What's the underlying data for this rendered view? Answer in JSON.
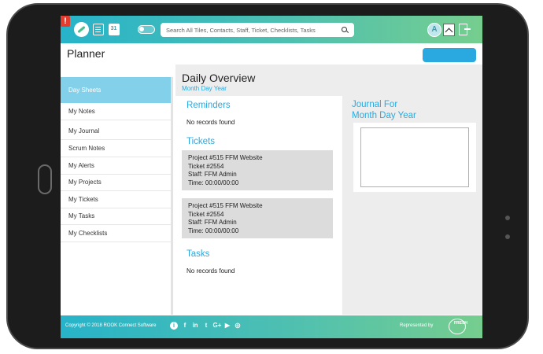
{
  "topbar": {
    "search_placeholder": "Search All Tiles, Contacts, Staff, Ticket, Checklists, Tasks",
    "avatar_letter": "A",
    "calendar_day": "31",
    "alert_mark": "!"
  },
  "header": {
    "title": "Planner"
  },
  "sidebar": {
    "items": [
      {
        "label": "Day Sheets",
        "active": true
      },
      {
        "label": "My Notes"
      },
      {
        "label": "My Journal"
      },
      {
        "label": "Scrum Notes"
      },
      {
        "label": "My Alerts"
      },
      {
        "label": "My Projects"
      },
      {
        "label": "My Tickets"
      },
      {
        "label": "My Tasks"
      },
      {
        "label": "My Checklists"
      }
    ]
  },
  "main": {
    "title": "Daily Overview",
    "subtitle": "Month Day Year",
    "reminders": {
      "title": "Reminders",
      "empty_text": "No records found"
    },
    "tickets": {
      "title": "Tickets",
      "items": [
        {
          "project": "Project #515 FFM Website",
          "ticket": "Ticket #2554",
          "staff": "Staff: FFM Admin",
          "time": "Time: 00:00/00:00"
        },
        {
          "project": "Project #515 FFM Website",
          "ticket": "Ticket #2554",
          "staff": "Staff: FFM Admin",
          "time": "Time: 00:00/00:00"
        }
      ]
    },
    "tasks": {
      "title": "Tasks",
      "empty_text": "No records found"
    },
    "journal": {
      "title_line1": "Journal For",
      "title_line2": "Month Day Year"
    }
  },
  "footer": {
    "copyright": "Copyright © 2018 ROOK Connect Software",
    "represented_by": "Represented by",
    "partner_logo_text": "FRESH",
    "social": [
      "i",
      "f",
      "in",
      "t",
      "G+",
      "▶",
      "◎"
    ]
  },
  "colors": {
    "accent": "#29a9df",
    "active_nav": "#82d0ea",
    "bar_gradient_start": "#27b3c9",
    "bar_gradient_end": "#76ce8e",
    "alert": "#e43d30"
  }
}
